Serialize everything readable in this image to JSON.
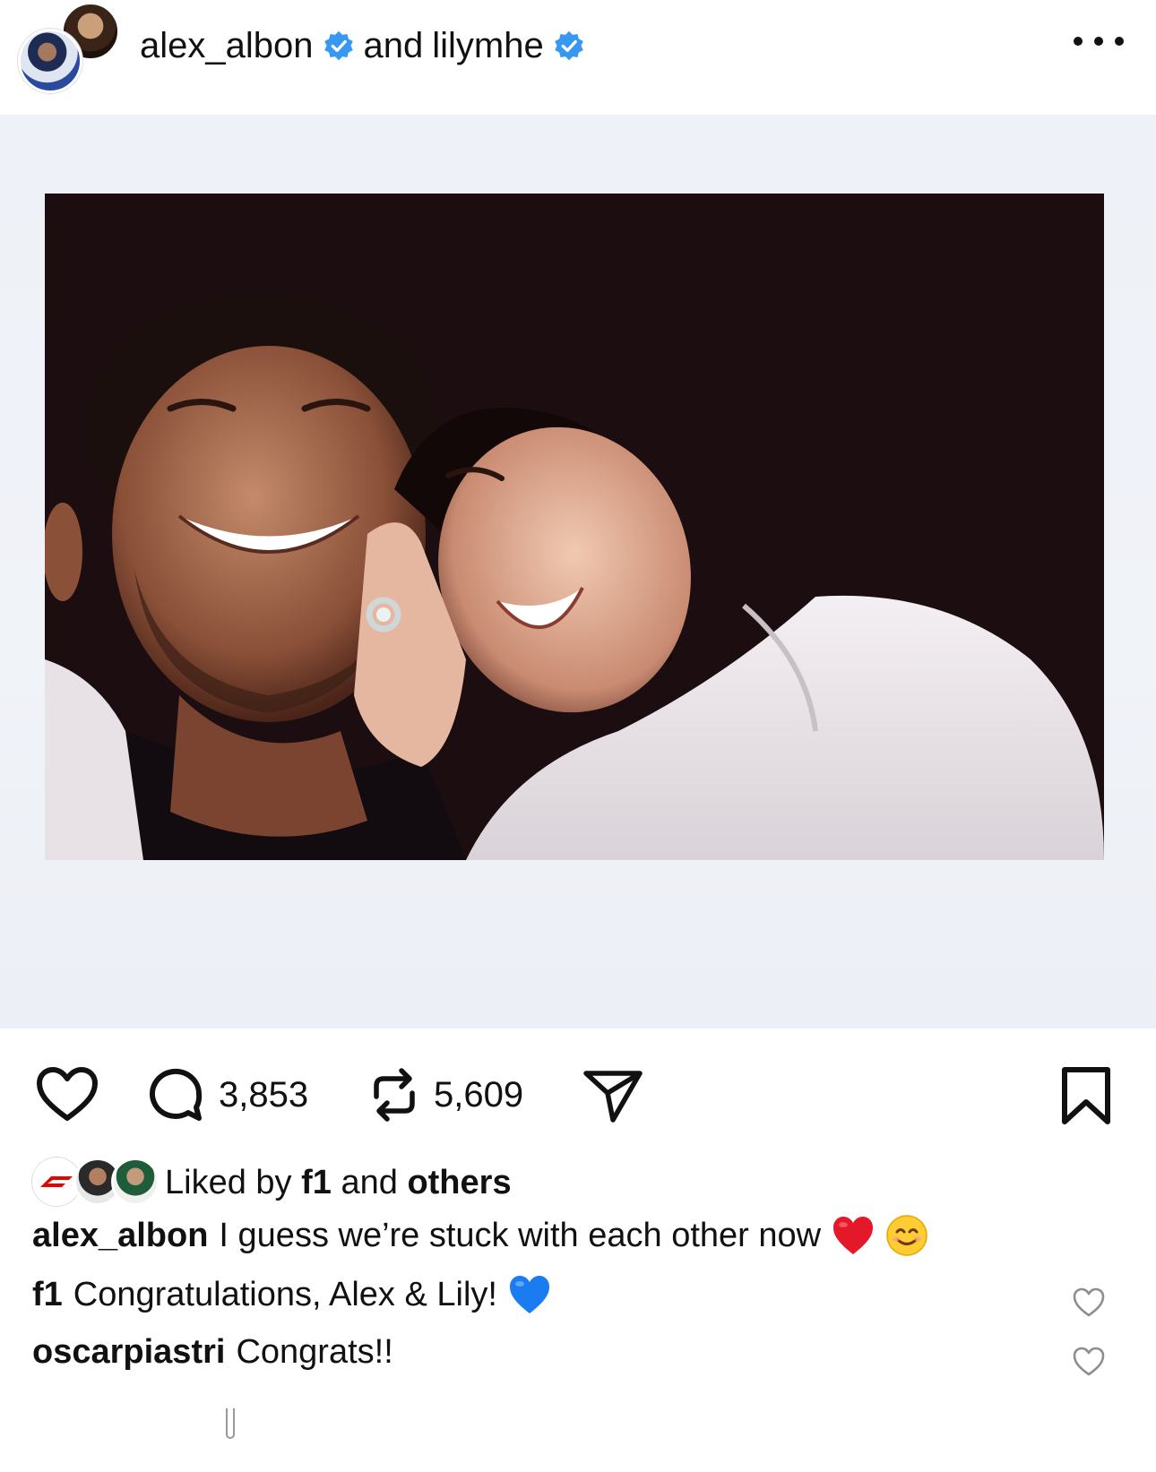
{
  "header": {
    "user1": "alex_albon",
    "connector": "and",
    "user2": "lilymhe"
  },
  "photo": {
    "alt": ""
  },
  "actions": {
    "comments_count": "3,853",
    "reposts_count": "5,609"
  },
  "likes": {
    "prefix": "Liked by",
    "user": "f1",
    "middle": "and",
    "others": "others"
  },
  "caption": {
    "user": "alex_albon",
    "text": "I guess we’re stuck with each other now",
    "emojis": [
      "red-heart",
      "smiling-face"
    ]
  },
  "comments": [
    {
      "user": "f1",
      "text": "Congratulations, Alex & Lily!",
      "emoji": "blue-heart"
    },
    {
      "user": "oscarpiastri",
      "text": "Congrats!!"
    }
  ],
  "colors": {
    "verified": "#3897f0",
    "heart_red": "#e3192a",
    "heart_blue": "#1a7cf0",
    "photo_bg": "#1b0d10",
    "frame_bg": "#eef1f7"
  }
}
